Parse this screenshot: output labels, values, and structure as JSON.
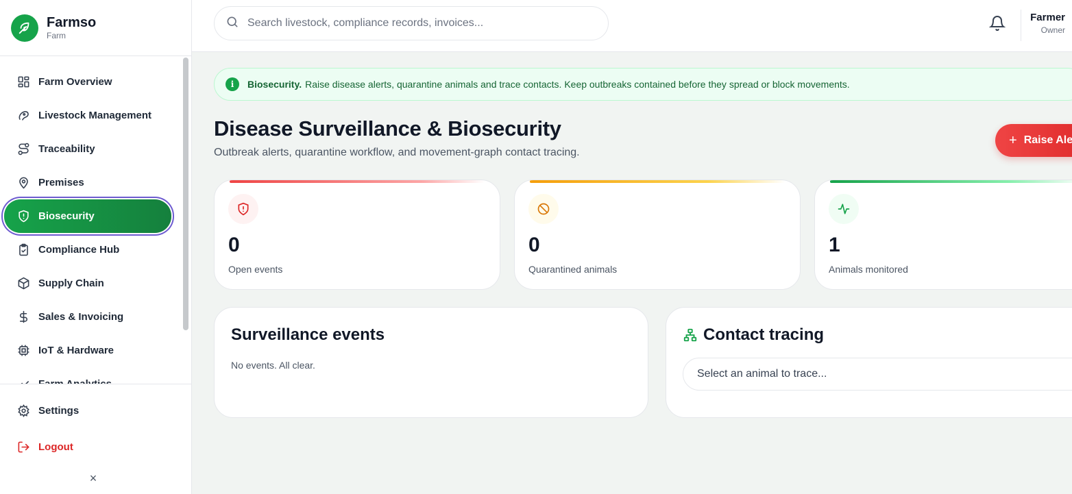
{
  "brand": {
    "name": "Farmso",
    "subtitle": "Farm"
  },
  "sidebar": {
    "items": [
      {
        "label": "Farm Overview",
        "icon": "grid-icon"
      },
      {
        "label": "Livestock Management",
        "icon": "livestock-icon"
      },
      {
        "label": "Traceability",
        "icon": "route-icon"
      },
      {
        "label": "Premises",
        "icon": "map-pin-icon"
      },
      {
        "label": "Biosecurity",
        "icon": "shield-icon",
        "active": true
      },
      {
        "label": "Compliance Hub",
        "icon": "clipboard-check-icon"
      },
      {
        "label": "Supply Chain",
        "icon": "box-icon"
      },
      {
        "label": "Sales & Invoicing",
        "icon": "dollar-icon"
      },
      {
        "label": "IoT & Hardware",
        "icon": "chip-icon"
      },
      {
        "label": "Farm Analytics",
        "icon": "analytics-icon"
      }
    ],
    "settings_label": "Settings",
    "logout_label": "Logout",
    "collapse_symbol": "×"
  },
  "topbar": {
    "search_placeholder": "Search livestock, compliance records, invoices...",
    "user_name": "Farmer",
    "user_role": "Owner"
  },
  "banner": {
    "title": "Biosecurity.",
    "text": "Raise disease alerts, quarantine animals and trace contacts. Keep outbreaks contained before they spread or block movements.",
    "icon_glyph": "i"
  },
  "page": {
    "title": "Disease Surveillance & Biosecurity",
    "subtitle": "Outbreak alerts, quarantine workflow, and movement-graph contact tracing.",
    "raise_button": "Raise Alert",
    "raise_plus": "+"
  },
  "stats": [
    {
      "value": "0",
      "label": "Open events",
      "icon": "alert-shield-icon",
      "accent": "#ef4444"
    },
    {
      "value": "0",
      "label": "Quarantined animals",
      "icon": "ban-icon",
      "accent": "#f59e0b"
    },
    {
      "value": "1",
      "label": "Animals monitored",
      "icon": "activity-icon",
      "accent": "#16a34a"
    }
  ],
  "surveillance": {
    "title": "Surveillance events",
    "empty_text": "No events. All clear."
  },
  "contact_tracing": {
    "title": "Contact tracing",
    "select_placeholder": "Select an animal to trace..."
  }
}
